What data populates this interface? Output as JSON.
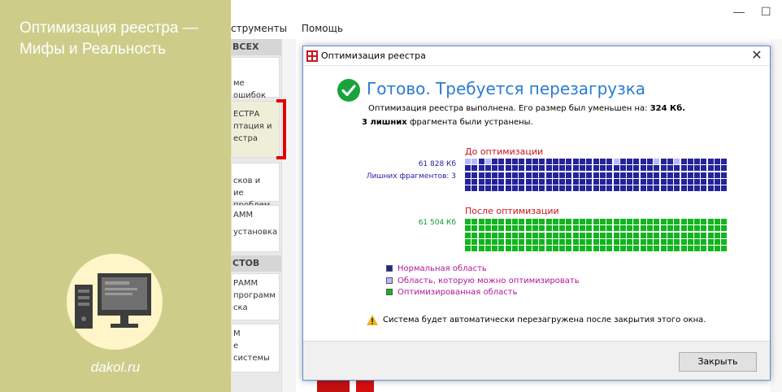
{
  "background_app": {
    "menu": [
      "струменты",
      "Помощь"
    ],
    "sidebar": {
      "section1_header": "ВСЕХ",
      "items": [
        {
          "lines": [
            "ме ошибок"
          ],
          "selected": false
        },
        {
          "lines": [
            "ЕСТРА",
            "птация и",
            "естра"
          ],
          "selected": true
        },
        {
          "lines": [
            "сков и",
            "ие проблем"
          ],
          "selected": false
        },
        {
          "lines": [
            "АММ",
            "установка"
          ],
          "selected": false
        }
      ],
      "section2_header": "СТОВ",
      "items2": [
        {
          "lines": [
            "РАММ",
            "программ",
            "ска"
          ]
        },
        {
          "lines": [
            "М",
            "е",
            "системы"
          ]
        }
      ]
    },
    "window_controls": [
      "—",
      "☐"
    ]
  },
  "overlay": {
    "title": "Оптимизация реестра — Мифы и Реальность",
    "site": "dakol.ru",
    "background_color": "#cdcd89",
    "icon": "computer-icon"
  },
  "dialog": {
    "title": "Оптимизация реестра",
    "close_icon": "close-icon",
    "heading": "Готово. Требуется перезагрузка",
    "line1_prefix": "Оптимизация реестра выполнена. Его размер был уменьшен на: ",
    "line1_value": "324 Кб.",
    "line2_bold": "3 лишних",
    "line2_rest": " фрагмента были устранены.",
    "before": {
      "label": "До оптимизации",
      "size": "61 828 Кб",
      "fragments": "Лишних фрагментов: 3"
    },
    "after": {
      "label": "После оптимизации",
      "size": "61 504 Кб"
    },
    "legend": [
      {
        "label": "Нормальная область",
        "color": "#24249a"
      },
      {
        "label": "Область, которую можно оптимизировать",
        "color": "#b9b9ff"
      },
      {
        "label": "Оптимизированная область",
        "color": "#13b51f"
      }
    ],
    "warning": "Система будет автоматически перезагружена после закрытия этого окна.",
    "close_button": "Закрыть"
  },
  "colors": {
    "accent_blue": "#2a7bd0",
    "red_label": "#c8161d",
    "blue_grid": "#24249a",
    "light_grid": "#b9b9ff",
    "green_grid": "#13b51f"
  }
}
